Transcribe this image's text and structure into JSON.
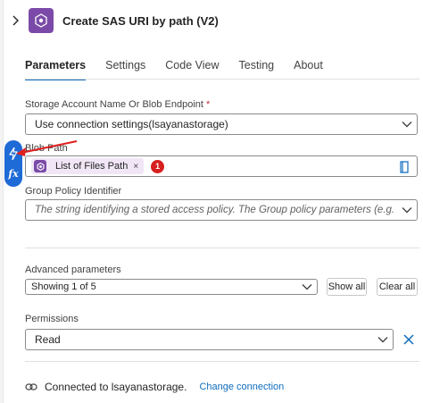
{
  "header": {
    "title": "Create SAS URI by path (V2)"
  },
  "tabs": [
    {
      "label": "Parameters"
    },
    {
      "label": "Settings"
    },
    {
      "label": "Code View"
    },
    {
      "label": "Testing"
    },
    {
      "label": "About"
    }
  ],
  "fields": {
    "storage_account": {
      "label": "Storage Account Name Or Blob Endpoint",
      "required_mark": "*",
      "value": "Use connection settings(lsayanastorage)"
    },
    "blob_path": {
      "label": "Blob Path",
      "token": "List of Files Path",
      "token_remove": "×",
      "badge": "1"
    },
    "group_policy": {
      "label": "Group Policy Identifier",
      "placeholder": "The string identifying a stored access policy. The Group policy parameters (e.g. Start..."
    }
  },
  "advanced": {
    "label": "Advanced parameters",
    "showing": "Showing 1 of 5",
    "show_all": "Show all",
    "clear_all": "Clear all"
  },
  "permissions": {
    "label": "Permissions",
    "value": "Read"
  },
  "footer": {
    "connected_text": "Connected to lsayanastorage.",
    "change_link": "Change connection"
  },
  "side_pill": {
    "fx_label": "fx"
  },
  "colors": {
    "accent": "#0f6cbd",
    "app_icon": "#7b4aa8",
    "badge": "#d61f1f",
    "pill": "#1e6ad6",
    "annotation_arrow": "#e02020"
  }
}
